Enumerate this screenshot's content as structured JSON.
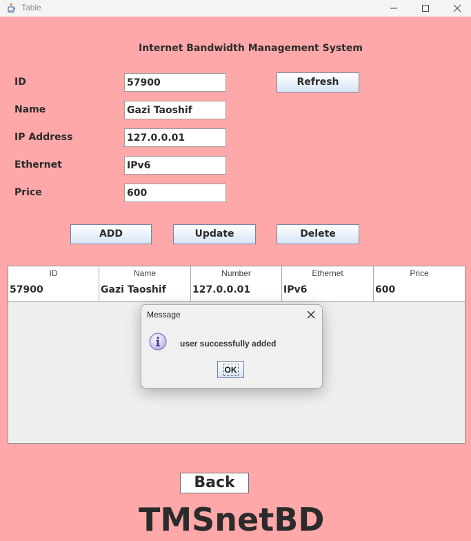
{
  "window": {
    "title": "Table",
    "icons": [
      "java-cup-icon",
      "minimize-icon",
      "maximize-icon",
      "close-icon"
    ]
  },
  "form": {
    "heading": "Internet Bandwidth Management System",
    "fields": [
      {
        "label": "ID",
        "value": "57900"
      },
      {
        "label": "Name",
        "value": "Gazi Taoshif"
      },
      {
        "label": "IP Address",
        "value": "127.0.0.01"
      },
      {
        "label": "Ethernet",
        "value": "IPv6"
      },
      {
        "label": "Price",
        "value": "600"
      }
    ],
    "buttons": {
      "refresh": "Refresh",
      "add": "ADD",
      "update": "Update",
      "delete": "Delete"
    }
  },
  "table": {
    "columns": [
      "ID",
      "Name",
      "Number",
      "Ethernet",
      "Price"
    ],
    "rows": [
      [
        "57900",
        "Gazi Taoshif",
        "127.0.0.01",
        "IPv6",
        "600"
      ]
    ]
  },
  "dialog": {
    "title": "Message",
    "message": "user successfully added",
    "ok": "OK",
    "icon": "info-icon"
  },
  "footer": {
    "back": "Back",
    "brand": "TMSnetBD"
  },
  "colors": {
    "background": "#ffa8aa",
    "button_gradient_bottom": "#d7e5f5"
  }
}
